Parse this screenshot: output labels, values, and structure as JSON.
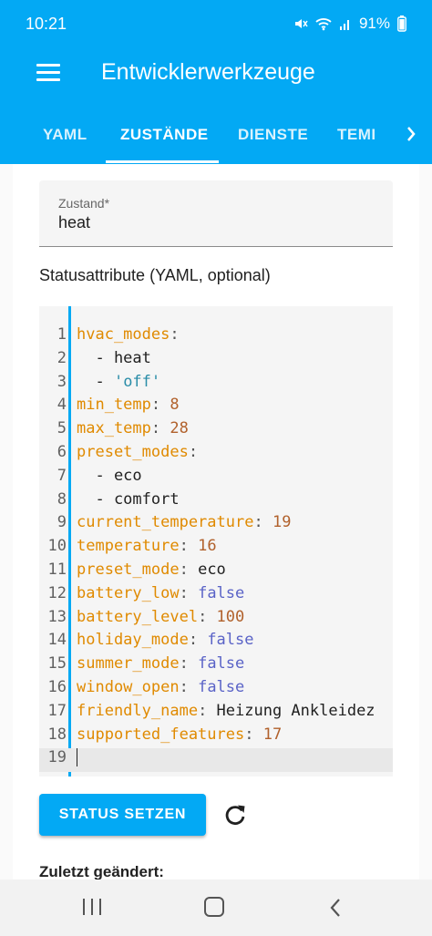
{
  "status_bar": {
    "time": "10:21",
    "battery": "91%"
  },
  "app_bar": {
    "title": "Entwicklerwerkzeuge",
    "menu_icon": "hamburger-menu-icon"
  },
  "tabs": [
    {
      "label": "YAML",
      "active": false
    },
    {
      "label": "ZUSTÄNDE",
      "active": true
    },
    {
      "label": "DIENSTE",
      "active": false
    },
    {
      "label": "TEMI",
      "active": false
    }
  ],
  "state_field": {
    "label": "Zustand*",
    "value": "heat"
  },
  "attributes_label": "Statusattribute (YAML, optional)",
  "editor": {
    "lines": [
      {
        "num": "1",
        "key": "hvac_modes",
        "sep": ":",
        "value": "",
        "vtype": ""
      },
      {
        "num": "2",
        "key": "",
        "sep": "",
        "value": "  - heat",
        "vtype": "plain"
      },
      {
        "num": "3",
        "key": "",
        "sep": "",
        "value": "  - 'off'",
        "vtype": "str"
      },
      {
        "num": "4",
        "key": "min_temp",
        "sep": ": ",
        "value": "8",
        "vtype": "num"
      },
      {
        "num": "5",
        "key": "max_temp",
        "sep": ": ",
        "value": "28",
        "vtype": "num"
      },
      {
        "num": "6",
        "key": "preset_modes",
        "sep": ":",
        "value": "",
        "vtype": ""
      },
      {
        "num": "7",
        "key": "",
        "sep": "",
        "value": "  - eco",
        "vtype": "plain"
      },
      {
        "num": "8",
        "key": "",
        "sep": "",
        "value": "  - comfort",
        "vtype": "plain"
      },
      {
        "num": "9",
        "key": "current_temperature",
        "sep": ": ",
        "value": "19",
        "vtype": "num"
      },
      {
        "num": "10",
        "key": "temperature",
        "sep": ": ",
        "value": "16",
        "vtype": "num"
      },
      {
        "num": "11",
        "key": "preset_mode",
        "sep": ": ",
        "value": "eco",
        "vtype": "plain"
      },
      {
        "num": "12",
        "key": "battery_low",
        "sep": ": ",
        "value": "false",
        "vtype": "bool"
      },
      {
        "num": "13",
        "key": "battery_level",
        "sep": ": ",
        "value": "100",
        "vtype": "num"
      },
      {
        "num": "14",
        "key": "holiday_mode",
        "sep": ": ",
        "value": "false",
        "vtype": "bool"
      },
      {
        "num": "15",
        "key": "summer_mode",
        "sep": ": ",
        "value": "false",
        "vtype": "bool"
      },
      {
        "num": "16",
        "key": "window_open",
        "sep": ": ",
        "value": "false",
        "vtype": "bool"
      },
      {
        "num": "17",
        "key": "friendly_name",
        "sep": ": ",
        "value": "Heizung Ankleidez",
        "vtype": "plain"
      },
      {
        "num": "18",
        "key": "supported_features",
        "sep": ": ",
        "value": "17",
        "vtype": "num"
      },
      {
        "num": "19",
        "key": "",
        "sep": "",
        "value": "",
        "vtype": "cursor"
      }
    ]
  },
  "set_state_button": "STATUS SETZEN",
  "reload_icon": "refresh-icon",
  "last_changed_label": "Zuletzt geändert:",
  "colors": {
    "primary": "#03a9f4",
    "yaml_key": "#e08a00",
    "yaml_number": "#b1612c",
    "yaml_bool": "#5a63c7",
    "yaml_string": "#2a8da8"
  }
}
